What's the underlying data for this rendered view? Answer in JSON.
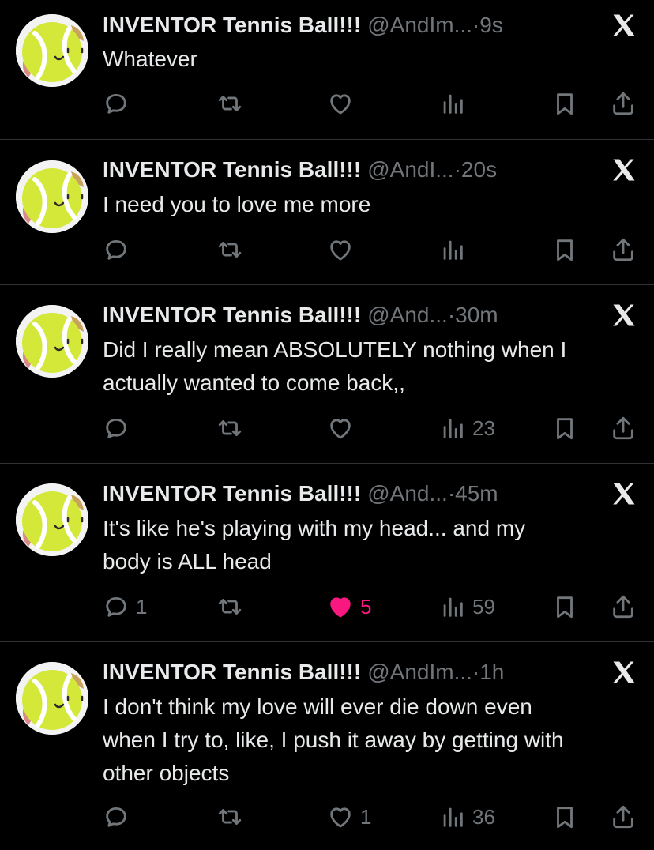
{
  "tweets": [
    {
      "name": "INVENTOR Tennis Ball!!!",
      "handle": "@AndIm...",
      "separator": "·",
      "time": "9s",
      "text": "Whatever",
      "replies": "",
      "likes": "",
      "views": ""
    },
    {
      "name": "INVENTOR Tennis Ball!!!",
      "handle": "@AndI...",
      "separator": "·",
      "time": "20s",
      "text": "I need you to love me more",
      "replies": "",
      "likes": "",
      "views": ""
    },
    {
      "name": "INVENTOR Tennis Ball!!!",
      "handle": "@And...",
      "separator": "·",
      "time": "30m",
      "text": "Did I really mean ABSOLUTELY nothing when I\nactually wanted to come back,,",
      "replies": "",
      "likes": "",
      "views": "23"
    },
    {
      "name": "INVENTOR Tennis Ball!!!",
      "handle": "@And...",
      "separator": "·",
      "time": "45m",
      "text": "It's like he's playing with my head... and my\nbody is ALL head",
      "replies": "1",
      "likes": "5",
      "views": "59",
      "liked": true
    },
    {
      "name": "INVENTOR Tennis Ball!!!",
      "handle": "@AndIm...",
      "separator": "·",
      "time": "1h",
      "text": "I don't think my love will ever die down even\nwhen I try to, like, I push it away by getting with\nother objects",
      "replies": "",
      "likes": "1",
      "views": "36"
    }
  ],
  "colors": {
    "background": "#000000",
    "text": "#e7e9ea",
    "secondary": "#71767b",
    "divider": "#2f3336",
    "like_active": "#f91880",
    "avatar_ball": "#d4e83a"
  },
  "icons": [
    "x-logo-icon",
    "reply-icon",
    "repost-icon",
    "like-icon",
    "views-icon",
    "bookmark-icon",
    "share-icon"
  ]
}
